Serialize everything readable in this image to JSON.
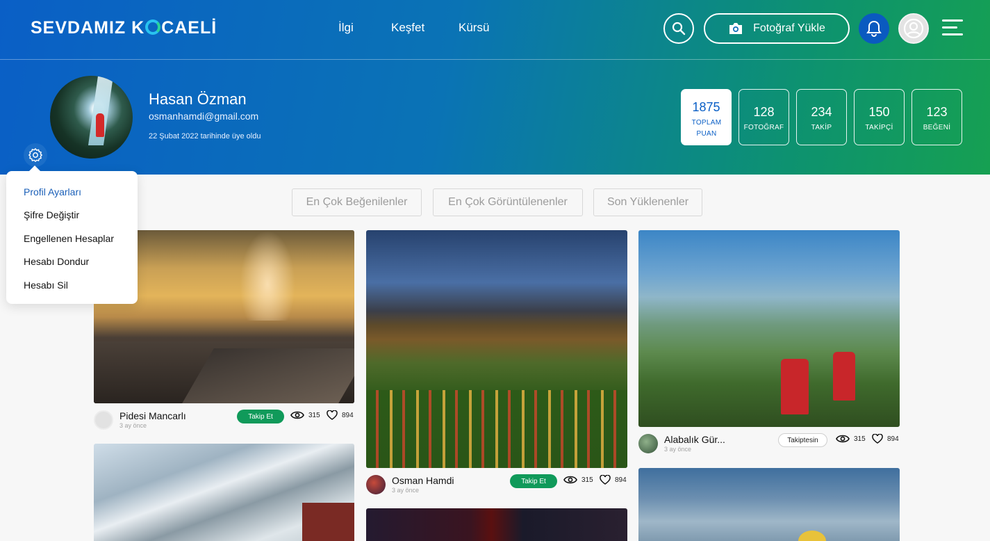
{
  "brand": {
    "part1": "SEVDAMIZ K",
    "part2": "CAELİ"
  },
  "nav": {
    "ilgi": "İlgi",
    "kesfet": "Keşfet",
    "kursu": "Kürsü"
  },
  "header": {
    "upload_label": "Fotoğraf Yükle"
  },
  "profile": {
    "name": "Hasan Özman",
    "email": "osmanhamdi@gmail.com",
    "member_since": "22 Şubat 2022 tarihinde üye oldu"
  },
  "stats": [
    {
      "value": "1875",
      "label": "TOPLAM PUAN"
    },
    {
      "value": "128",
      "label": "FOTOĞRAF"
    },
    {
      "value": "234",
      "label": "TAKİP"
    },
    {
      "value": "150",
      "label": "TAKİPÇİ"
    },
    {
      "value": "123",
      "label": "BEĞENİ"
    }
  ],
  "settings_menu": [
    "Profil Ayarları",
    "Şifre Değiştir",
    "Engellenen Hesaplar",
    "Hesabı Dondur",
    "Hesabı Sil"
  ],
  "tabs": [
    "En Çok Beğenilenler",
    "En Çok Görüntülenenler",
    "Son Yüklenenler"
  ],
  "posts": [
    {
      "author": "Pidesi Mancarlı",
      "time": "3 ay önce",
      "action": "Takip Et",
      "views": "315",
      "likes": "894"
    },
    {
      "author": "Osman Hamdi",
      "time": "3 ay önce",
      "action": "Takip Et",
      "views": "315",
      "likes": "894"
    },
    {
      "author": "Alabalık Gür...",
      "time": "3 ay önce",
      "action": "Takiptesin",
      "views": "315",
      "likes": "894"
    }
  ]
}
